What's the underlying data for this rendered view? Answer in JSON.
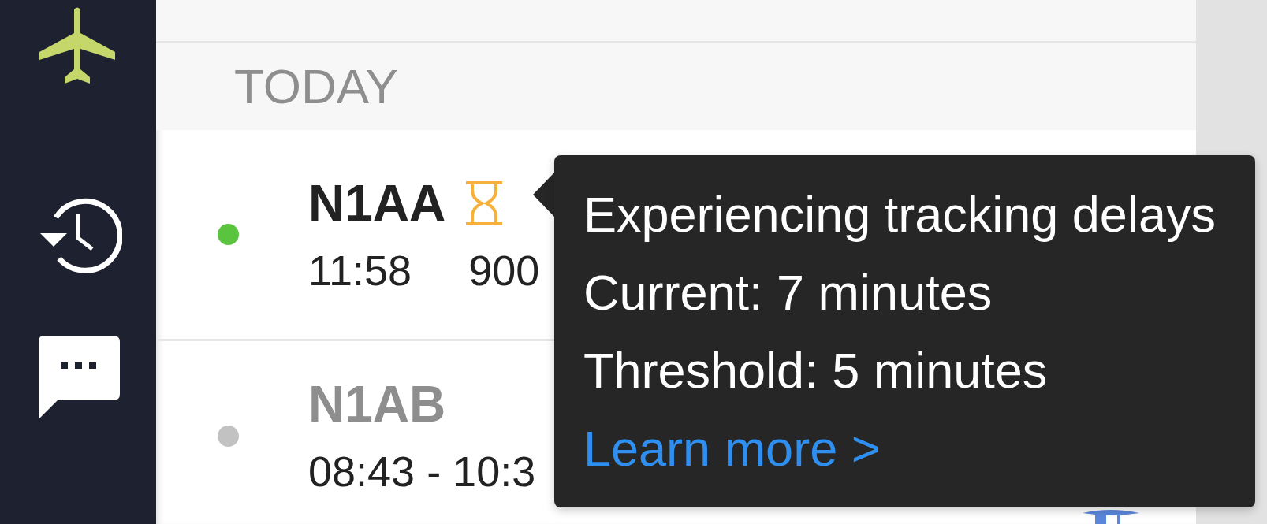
{
  "sidebar": {
    "items": [
      {
        "kind": "flights",
        "selected": true
      },
      {
        "kind": "history",
        "selected": false
      },
      {
        "kind": "messages",
        "selected": false
      }
    ]
  },
  "section_label": "TODAY",
  "flights": [
    {
      "tail": "N1AA",
      "active": true,
      "delayed": true,
      "color": "#5ac43f",
      "time": "11:58",
      "column_2": "900"
    },
    {
      "tail": "N1AB",
      "active": false,
      "delayed": false,
      "color": "#c2c2c2",
      "time": "08:43 - 10:3"
    }
  ],
  "tooltip": {
    "title": "Experiencing tracking delays",
    "lines": [
      "Current: 7 minutes",
      "Threshold: 5 minutes"
    ],
    "link": "Learn more >"
  }
}
